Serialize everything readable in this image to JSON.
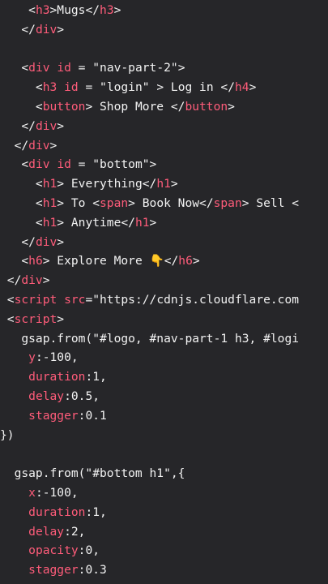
{
  "code_lines": [
    [
      {
        "t": "    <",
        "c": "punc"
      },
      {
        "t": "h3",
        "c": "tag"
      },
      {
        "t": ">Mugs</",
        "c": "punc"
      },
      {
        "t": "h3",
        "c": "tag"
      },
      {
        "t": ">",
        "c": "punc"
      }
    ],
    [
      {
        "t": "   </",
        "c": "punc"
      },
      {
        "t": "div",
        "c": "tag"
      },
      {
        "t": ">",
        "c": "punc"
      }
    ],
    [],
    [
      {
        "t": "   <",
        "c": "punc"
      },
      {
        "t": "div",
        "c": "tag"
      },
      {
        "t": " ",
        "c": "punc"
      },
      {
        "t": "id",
        "c": "attr"
      },
      {
        "t": " = ",
        "c": "punc"
      },
      {
        "t": "\"nav-part-2\"",
        "c": "str"
      },
      {
        "t": ">",
        "c": "punc"
      }
    ],
    [
      {
        "t": "     <",
        "c": "punc"
      },
      {
        "t": "h3",
        "c": "tag"
      },
      {
        "t": " ",
        "c": "punc"
      },
      {
        "t": "id",
        "c": "attr"
      },
      {
        "t": " = ",
        "c": "punc"
      },
      {
        "t": "\"login\"",
        "c": "str"
      },
      {
        "t": " > Log in </",
        "c": "punc"
      },
      {
        "t": "h4",
        "c": "tag"
      },
      {
        "t": ">",
        "c": "punc"
      }
    ],
    [
      {
        "t": "     <",
        "c": "punc"
      },
      {
        "t": "button",
        "c": "tag"
      },
      {
        "t": "> Shop More </",
        "c": "punc"
      },
      {
        "t": "button",
        "c": "tag"
      },
      {
        "t": ">",
        "c": "punc"
      }
    ],
    [
      {
        "t": "   </",
        "c": "punc"
      },
      {
        "t": "div",
        "c": "tag"
      },
      {
        "t": ">",
        "c": "punc"
      }
    ],
    [
      {
        "t": "  </",
        "c": "punc"
      },
      {
        "t": "div",
        "c": "tag"
      },
      {
        "t": ">",
        "c": "punc"
      }
    ],
    [
      {
        "t": "   <",
        "c": "punc"
      },
      {
        "t": "div",
        "c": "tag"
      },
      {
        "t": " ",
        "c": "punc"
      },
      {
        "t": "id",
        "c": "attr"
      },
      {
        "t": " = ",
        "c": "punc"
      },
      {
        "t": "\"bottom\"",
        "c": "str"
      },
      {
        "t": ">",
        "c": "punc"
      }
    ],
    [
      {
        "t": "     <",
        "c": "punc"
      },
      {
        "t": "h1",
        "c": "tag"
      },
      {
        "t": "> Everything</",
        "c": "punc"
      },
      {
        "t": "h1",
        "c": "tag"
      },
      {
        "t": ">",
        "c": "punc"
      }
    ],
    [
      {
        "t": "     <",
        "c": "punc"
      },
      {
        "t": "h1",
        "c": "tag"
      },
      {
        "t": "> To <",
        "c": "punc"
      },
      {
        "t": "span",
        "c": "tag"
      },
      {
        "t": "> Book Now</",
        "c": "punc"
      },
      {
        "t": "span",
        "c": "tag"
      },
      {
        "t": "> Sell <",
        "c": "punc"
      }
    ],
    [
      {
        "t": "     <",
        "c": "punc"
      },
      {
        "t": "h1",
        "c": "tag"
      },
      {
        "t": "> Anytime</",
        "c": "punc"
      },
      {
        "t": "h1",
        "c": "tag"
      },
      {
        "t": ">",
        "c": "punc"
      }
    ],
    [
      {
        "t": "   </",
        "c": "punc"
      },
      {
        "t": "div",
        "c": "tag"
      },
      {
        "t": ">",
        "c": "punc"
      }
    ],
    [
      {
        "t": "   <",
        "c": "punc"
      },
      {
        "t": "h6",
        "c": "tag"
      },
      {
        "t": "> Explore More ",
        "c": "punc"
      },
      {
        "t": "👇",
        "c": "emoji"
      },
      {
        "t": "</",
        "c": "punc"
      },
      {
        "t": "h6",
        "c": "tag"
      },
      {
        "t": ">",
        "c": "punc"
      }
    ],
    [
      {
        "t": " </",
        "c": "punc"
      },
      {
        "t": "div",
        "c": "tag"
      },
      {
        "t": ">",
        "c": "punc"
      }
    ],
    [
      {
        "t": " <",
        "c": "punc"
      },
      {
        "t": "script",
        "c": "tag"
      },
      {
        "t": " ",
        "c": "punc"
      },
      {
        "t": "src",
        "c": "attr"
      },
      {
        "t": "=\"https://cdnjs.cloudflare.com",
        "c": "str"
      }
    ],
    [
      {
        "t": " <",
        "c": "punc"
      },
      {
        "t": "script",
        "c": "tag"
      },
      {
        "t": ">",
        "c": "punc"
      }
    ],
    [
      {
        "t": "   gsap.from(\"#logo, #nav-part-1 h3, #logi",
        "c": "txt"
      }
    ],
    [
      {
        "t": "    ",
        "c": "txt"
      },
      {
        "t": "y",
        "c": "tag"
      },
      {
        "t": ":-100,",
        "c": "num"
      }
    ],
    [
      {
        "t": "    ",
        "c": "txt"
      },
      {
        "t": "duration",
        "c": "tag"
      },
      {
        "t": ":1,",
        "c": "num"
      }
    ],
    [
      {
        "t": "    ",
        "c": "txt"
      },
      {
        "t": "delay",
        "c": "tag"
      },
      {
        "t": ":0.5,",
        "c": "num"
      }
    ],
    [
      {
        "t": "    ",
        "c": "txt"
      },
      {
        "t": "stagger",
        "c": "tag"
      },
      {
        "t": ":0.1",
        "c": "num"
      }
    ],
    [
      {
        "t": "})",
        "c": "txt"
      }
    ],
    [],
    [
      {
        "t": "  gsap.from(\"#bottom h1\",{",
        "c": "txt"
      }
    ],
    [
      {
        "t": "    ",
        "c": "txt"
      },
      {
        "t": "x",
        "c": "tag"
      },
      {
        "t": ":-100,",
        "c": "num"
      }
    ],
    [
      {
        "t": "    ",
        "c": "txt"
      },
      {
        "t": "duration",
        "c": "tag"
      },
      {
        "t": ":1,",
        "c": "num"
      }
    ],
    [
      {
        "t": "    ",
        "c": "txt"
      },
      {
        "t": "delay",
        "c": "tag"
      },
      {
        "t": ":2,",
        "c": "num"
      }
    ],
    [
      {
        "t": "    ",
        "c": "txt"
      },
      {
        "t": "opacity",
        "c": "tag"
      },
      {
        "t": ":0,",
        "c": "num"
      }
    ],
    [
      {
        "t": "    ",
        "c": "txt"
      },
      {
        "t": "stagger",
        "c": "tag"
      },
      {
        "t": ":0.3",
        "c": "num"
      }
    ]
  ]
}
